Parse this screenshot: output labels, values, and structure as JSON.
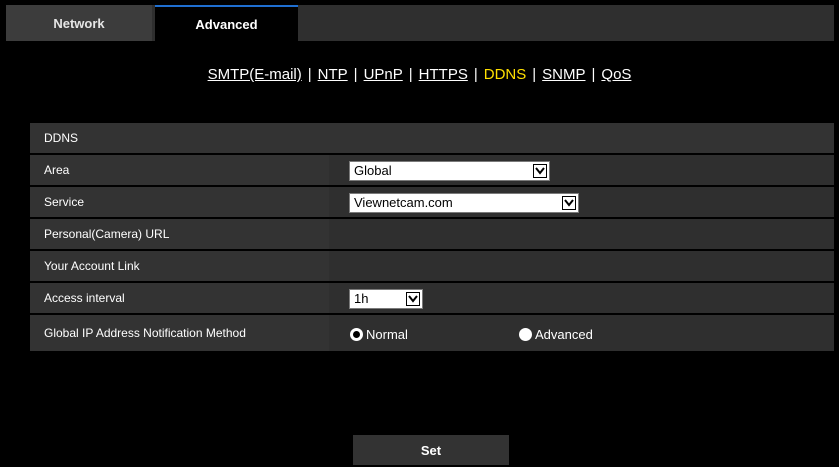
{
  "tabs": [
    {
      "label": "Network"
    },
    {
      "label": "Advanced"
    }
  ],
  "subnav": {
    "links": [
      {
        "label": "SMTP(E-mail)"
      },
      {
        "label": "NTP"
      },
      {
        "label": "UPnP"
      },
      {
        "label": "HTTPS"
      },
      {
        "label": "DDNS"
      },
      {
        "label": "SNMP"
      },
      {
        "label": "QoS"
      }
    ],
    "separator": "|",
    "active_color": "#ffe000"
  },
  "section": {
    "title": "DDNS"
  },
  "rows": {
    "area": {
      "label": "Area",
      "value": "Global"
    },
    "service": {
      "label": "Service",
      "value": "Viewnetcam.com"
    },
    "personal_url": {
      "label": "Personal(Camera) URL",
      "value": ""
    },
    "account_link": {
      "label": "Your Account Link",
      "value": ""
    },
    "access_interval": {
      "label": "Access interval",
      "value": "1h"
    },
    "notification": {
      "label": "Global IP Address Notification Method",
      "options": [
        {
          "label": "Normal",
          "checked": true
        },
        {
          "label": "Advanced",
          "checked": false
        }
      ]
    }
  },
  "set_button": {
    "label": "Set"
  },
  "icons": {
    "dropdown": "chevron-down-icon",
    "radio": "radio-icon"
  }
}
